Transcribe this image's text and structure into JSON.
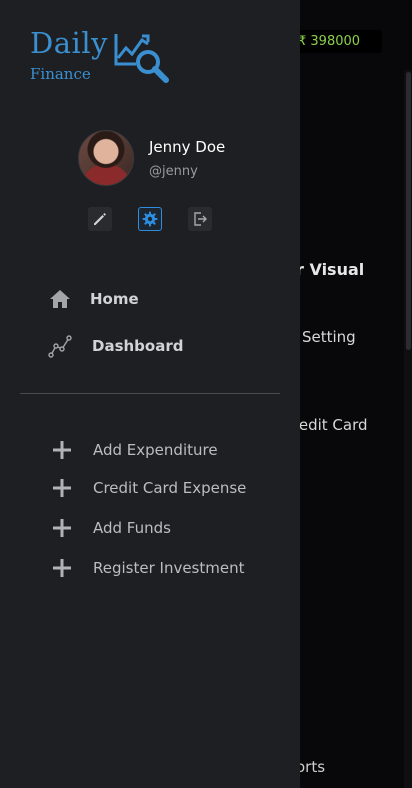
{
  "background": {
    "balance": "₹ 398000",
    "heading_fragment": "r Visual",
    "setting_fragment": "Setting",
    "credit_fragment": "redit Card",
    "reports_fragment": "orts"
  },
  "brand": {
    "name_line1": "Daily",
    "name_line2": "Finance",
    "logo_icon": "chart-magnifier-icon",
    "color": "#3a8fd1"
  },
  "profile": {
    "name": "Jenny Doe",
    "handle": "@jenny"
  },
  "profile_actions": [
    {
      "icon": "pencil-icon",
      "active": false
    },
    {
      "icon": "gear-icon",
      "active": true
    },
    {
      "icon": "logout-icon",
      "active": false
    }
  ],
  "nav": [
    {
      "label": "Home",
      "icon": "home-icon"
    },
    {
      "label": "Dashboard",
      "icon": "graph-nodes-icon"
    }
  ],
  "actions": [
    {
      "label": "Add Expenditure",
      "icon": "plus-icon"
    },
    {
      "label": "Credit Card Expense",
      "icon": "plus-icon"
    },
    {
      "label": "Add Funds",
      "icon": "plus-icon"
    },
    {
      "label": "Register Investment",
      "icon": "plus-icon"
    }
  ],
  "colors": {
    "drawer_bg": "#1e1f22",
    "accent": "#2d8ee0",
    "balance_text": "#8bd04a"
  }
}
